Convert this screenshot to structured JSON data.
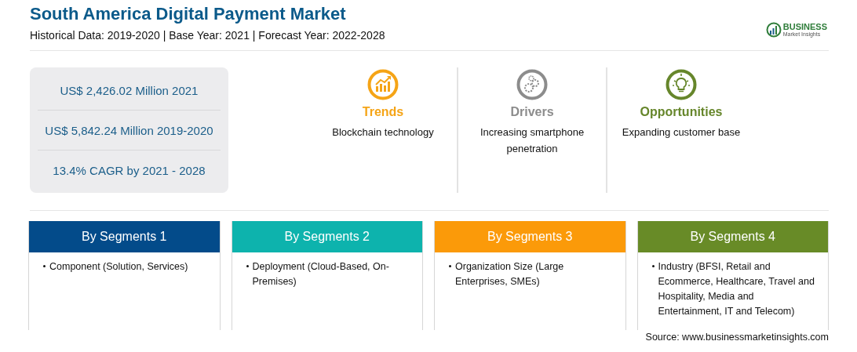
{
  "title": "South America Digital Payment Market",
  "subtitle": "Historical Data: 2019-2020 | Base Year: 2021 | Forecast Year: 2022-2028",
  "logo": {
    "name": "BUSINESS",
    "tagline": "Market Insights"
  },
  "stats": [
    "US$ 2,426.02 Million 2021",
    "US$ 5,842.24 Million 2019-2020",
    "13.4% CAGR by 2021 - 2028"
  ],
  "insights": [
    {
      "kind": "trends",
      "label": "Trends",
      "color": "#f5a416",
      "text": "Blockchain technology"
    },
    {
      "kind": "drivers",
      "label": "Drivers",
      "color": "#8c8c8c",
      "text": "Increasing smartphone penetration"
    },
    {
      "kind": "opportunities",
      "label": "Opportunities",
      "color": "#66862b",
      "text": "Expanding customer base"
    }
  ],
  "segments": [
    {
      "title": "By Segments 1",
      "color": "#034b8a",
      "items": [
        "Component (Solution, Services)"
      ]
    },
    {
      "title": "By Segments 2",
      "color": "#0db3ad",
      "items": [
        "Deployment (Cloud-Based, On-Premises)"
      ]
    },
    {
      "title": "By Segments 3",
      "color": "#fb9a09",
      "items": [
        "Organization Size (Large Enterprises, SMEs)"
      ]
    },
    {
      "title": "By Segments 4",
      "color": "#688b27",
      "items": [
        "Industry (BFSI, Retail and Ecommerce, Healthcare, Travel and Hospitality, Media and Entertainment, IT and Telecom)"
      ]
    }
  ],
  "source": "Source: www.businessmarketinsights.com"
}
